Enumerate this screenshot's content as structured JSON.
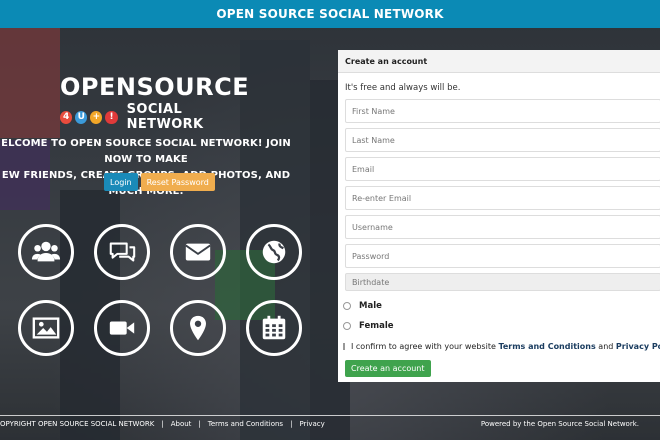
{
  "header": {
    "title": "OPEN SOURCE SOCIAL NETWORK"
  },
  "logo": {
    "main": "OPENSOURCE",
    "badges": [
      {
        "text": "4",
        "color": "#e84c3d"
      },
      {
        "text": "U",
        "color": "#3b9ad9"
      },
      {
        "text": "+",
        "color": "#f1a628"
      },
      {
        "text": "!",
        "color": "#e03a3a"
      }
    ],
    "sub": "SOCIAL NETWORK"
  },
  "welcome": {
    "line1": "ELCOME TO OPEN SOURCE SOCIAL NETWORK! JOIN NOW TO MAKE",
    "line2": "EW FRIENDS, CREATE GROUPS, ADD PHOTOS, AND MUCH MORE."
  },
  "actions": {
    "login": "Login",
    "reset": "Reset Password"
  },
  "features": [
    {
      "icon": "users-icon"
    },
    {
      "icon": "chat-icon"
    },
    {
      "icon": "envelope-icon"
    },
    {
      "icon": "globe-icon"
    },
    {
      "icon": "image-icon"
    },
    {
      "icon": "video-icon"
    },
    {
      "icon": "location-pin-icon"
    },
    {
      "icon": "calendar-icon"
    }
  ],
  "signup": {
    "heading": "Create an account",
    "tagline": "It's free and always will be.",
    "fields": {
      "first_name": "First Name",
      "last_name": "Last Name",
      "email": "Email",
      "reemail": "Re-enter Email",
      "username": "Username",
      "password": "Password",
      "birthdate": "Birthdate"
    },
    "gender": {
      "male": "Male",
      "female": "Female"
    },
    "terms": {
      "prefix": "I confirm to agree with your website",
      "terms_link": "Terms and Conditions",
      "and": "and",
      "privacy_link": "Privacy Policy"
    },
    "submit": "Create an account"
  },
  "footer": {
    "copyright": "OPYRIGHT OPEN SOURCE SOCIAL NETWORK",
    "links": [
      "About",
      "Terms and Conditions",
      "Privacy"
    ],
    "powered": "Powered by the Open Source Social Network."
  },
  "colors": {
    "accent": "#0b8ab5",
    "login": "#1a8ab8",
    "reset": "#f0ad4e",
    "create": "#3fa34d"
  }
}
